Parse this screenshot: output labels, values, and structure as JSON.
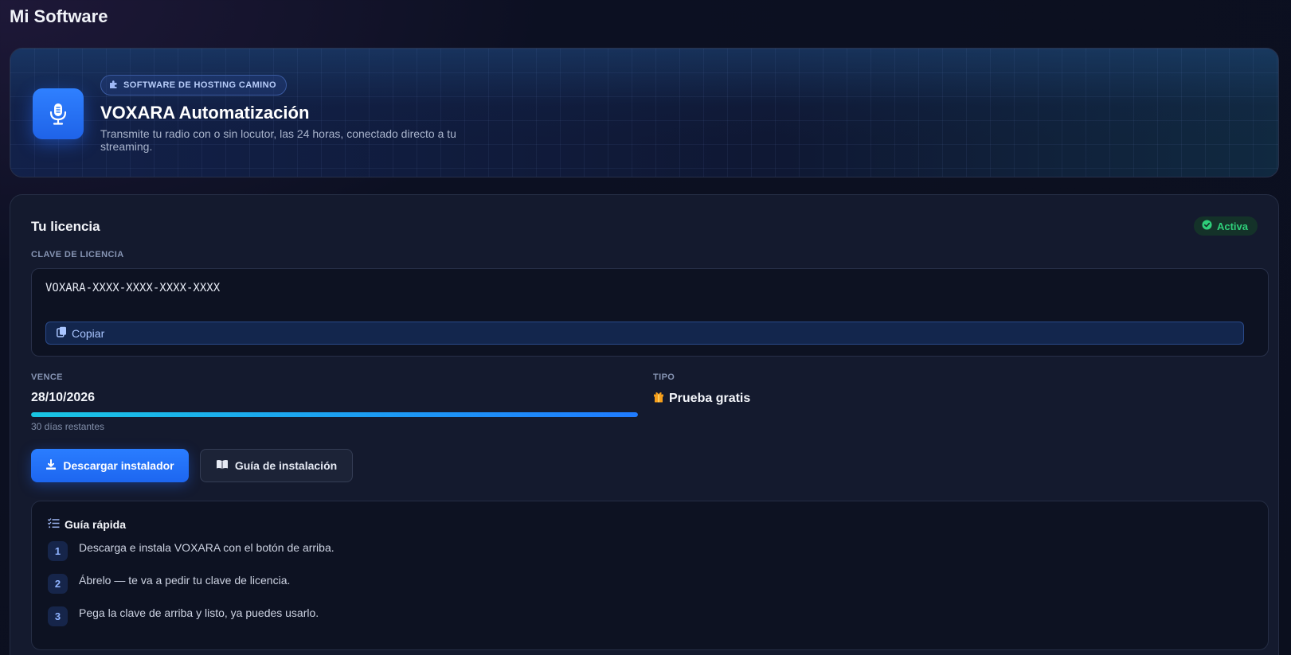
{
  "page": {
    "title": "Mi Software"
  },
  "hero": {
    "icon": "microphone-icon",
    "badge_icon": "puzzle-icon",
    "badge": "SOFTWARE DE HOSTING CAMINO",
    "title": "VOXARA Automatización",
    "description": "Transmite tu radio con o sin locutor, las 24 horas, conectado directo a tu streaming."
  },
  "license": {
    "title": "Tu licencia",
    "status": {
      "label": "Activa",
      "icon": "check-circle-icon",
      "color": "#2fd07a"
    },
    "key": {
      "label": "CLAVE DE LICENCIA",
      "value": "VOXARA-XXXX-XXXX-XXXX-XXXX",
      "copy_label": "Copiar",
      "copy_icon": "copy-icon"
    },
    "expires": {
      "label": "VENCE",
      "date": "28/10/2026",
      "progress_fraction": 1.0,
      "remaining": "30 días restantes"
    },
    "type": {
      "label": "TIPO",
      "icon": "gift-icon",
      "value": "Prueba gratis"
    },
    "actions": {
      "download_label": "Descargar instalador",
      "download_icon": "download-icon",
      "guide_label": "Guía de instalación",
      "guide_icon": "book-icon"
    },
    "quick_guide": {
      "title": "Guía rápida",
      "icon": "list-check-icon",
      "steps": [
        {
          "num": "1",
          "text": "Descarga e instala VOXARA con el botón de arriba."
        },
        {
          "num": "2",
          "text": "Ábrelo — te va a pedir tu clave de licencia."
        },
        {
          "num": "3",
          "text": "Pega la clave de arriba y listo, ya puedes usarlo."
        }
      ]
    }
  },
  "colors": {
    "accent": "#2a7dff",
    "success": "#2fd07a"
  }
}
